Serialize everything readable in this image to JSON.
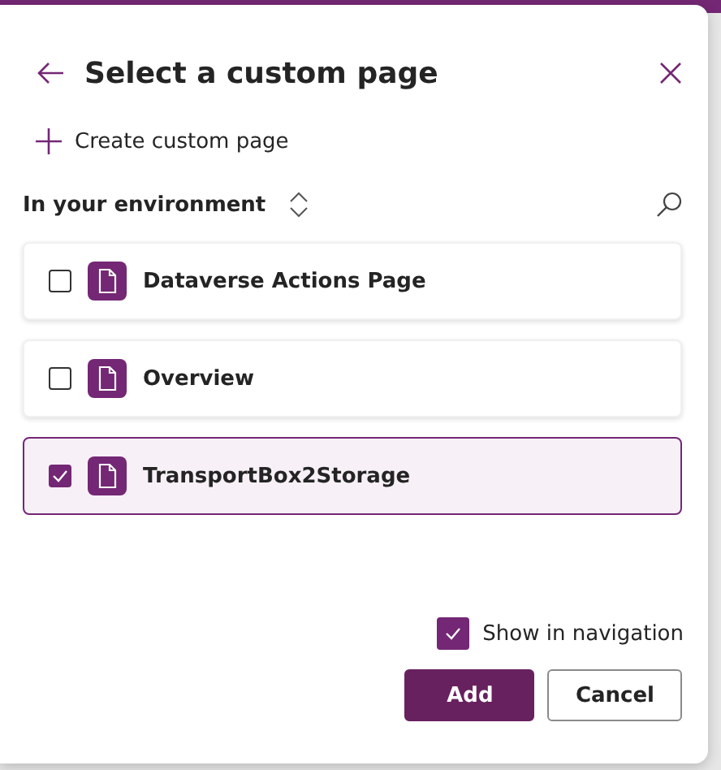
{
  "dialog": {
    "title": "Select a custom page",
    "create_label": "Create custom page",
    "filter_label": "In your environment"
  },
  "pages": [
    {
      "name": "Dataverse Actions Page",
      "selected": false
    },
    {
      "name": "Overview",
      "selected": false
    },
    {
      "name": "TransportBox2Storage",
      "selected": true
    }
  ],
  "show_in_navigation": {
    "label": "Show in navigation",
    "checked": true
  },
  "buttons": [
    {
      "label": "Add",
      "kind": "primary"
    },
    {
      "label": "Cancel",
      "kind": "secondary"
    }
  ]
}
